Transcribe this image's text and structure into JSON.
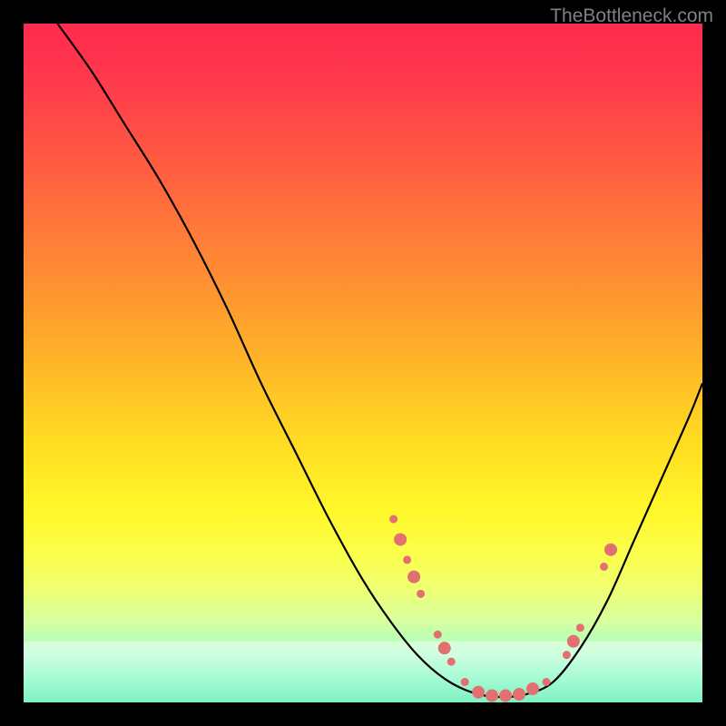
{
  "watermark": "TheBottleneck.com",
  "chart_data": {
    "type": "line",
    "title": "",
    "xlabel": "",
    "ylabel": "",
    "xlim": [
      0,
      100
    ],
    "ylim": [
      0,
      100
    ],
    "curve": {
      "name": "bottleneck-curve",
      "points": [
        [
          5,
          100
        ],
        [
          10,
          93
        ],
        [
          15,
          85
        ],
        [
          20,
          77
        ],
        [
          25,
          68
        ],
        [
          30,
          58
        ],
        [
          35,
          47
        ],
        [
          40,
          37
        ],
        [
          45,
          27
        ],
        [
          50,
          18
        ],
        [
          54,
          12
        ],
        [
          58,
          7
        ],
        [
          62,
          3.5
        ],
        [
          66,
          1.5
        ],
        [
          70,
          0.8
        ],
        [
          74,
          1.2
        ],
        [
          78,
          3
        ],
        [
          82,
          8
        ],
        [
          86,
          15
        ],
        [
          90,
          24
        ],
        [
          94,
          33
        ],
        [
          98,
          42
        ],
        [
          100,
          47
        ]
      ]
    },
    "highlight_band": {
      "y_range": [
        0,
        9
      ],
      "color": "#ffffff",
      "opacity": 0.48
    },
    "markers": {
      "name": "data-points",
      "color": "#e27070",
      "radius_small": 4.5,
      "radius_large": 7,
      "points": [
        {
          "x": 54.5,
          "y": 27,
          "r": "small"
        },
        {
          "x": 55.5,
          "y": 24,
          "r": "large"
        },
        {
          "x": 56.5,
          "y": 21,
          "r": "small"
        },
        {
          "x": 57.5,
          "y": 18.5,
          "r": "large"
        },
        {
          "x": 58.5,
          "y": 16,
          "r": "small"
        },
        {
          "x": 61,
          "y": 10,
          "r": "small"
        },
        {
          "x": 62,
          "y": 8,
          "r": "large"
        },
        {
          "x": 63,
          "y": 6,
          "r": "small"
        },
        {
          "x": 65,
          "y": 3,
          "r": "small"
        },
        {
          "x": 67,
          "y": 1.5,
          "r": "large"
        },
        {
          "x": 69,
          "y": 1,
          "r": "large"
        },
        {
          "x": 71,
          "y": 1,
          "r": "large"
        },
        {
          "x": 73,
          "y": 1.2,
          "r": "large"
        },
        {
          "x": 75,
          "y": 2,
          "r": "large"
        },
        {
          "x": 77,
          "y": 3,
          "r": "small"
        },
        {
          "x": 80,
          "y": 7,
          "r": "small"
        },
        {
          "x": 81,
          "y": 9,
          "r": "large"
        },
        {
          "x": 82,
          "y": 11,
          "r": "small"
        },
        {
          "x": 85.5,
          "y": 20,
          "r": "small"
        },
        {
          "x": 86.5,
          "y": 22.5,
          "r": "large"
        }
      ]
    }
  }
}
